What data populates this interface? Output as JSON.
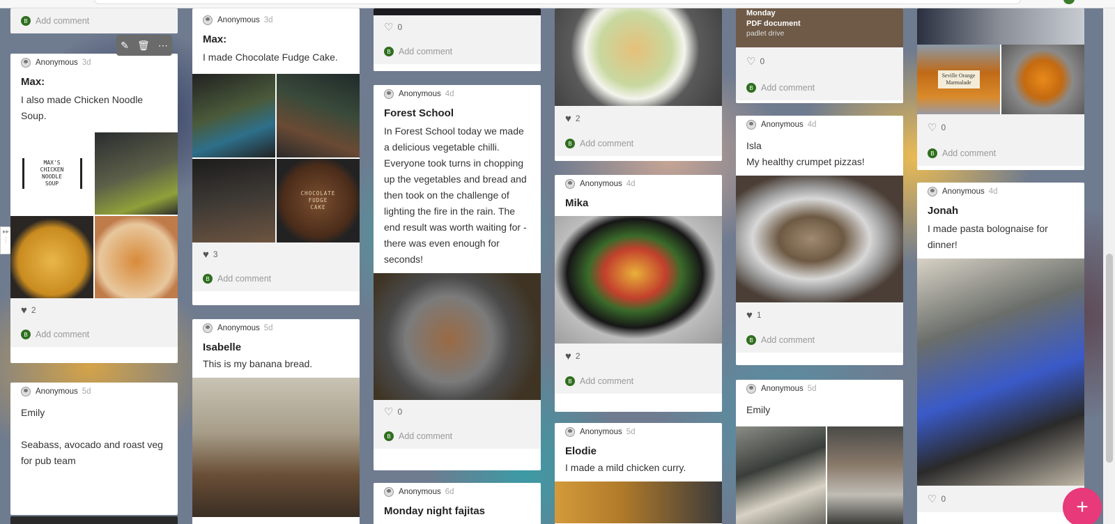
{
  "columns": [
    {
      "posts": [
        {
          "footer_only": true,
          "comment": "Add comment"
        },
        {
          "author": "Anonymous",
          "time": "3d",
          "title": "Max:",
          "body": "I also made Chicken Noodle Soup.",
          "likes": "2",
          "liked": true,
          "comment": "Add comment",
          "image_text": [
            "MAX'S",
            "CHICKEN",
            "NOODLE",
            "SOUP"
          ]
        },
        {
          "author": "Anonymous",
          "time": "5d",
          "title": "",
          "body": "Emily\n\nSeabass, avocado and roast veg for pub team"
        }
      ]
    },
    {
      "posts": [
        {
          "author": "Anonymous",
          "time": "3d",
          "title": "Max:",
          "body": "I made Chocolate Fudge Cake.",
          "likes": "3",
          "liked": true,
          "comment": "Add comment",
          "image_text": [
            "CHOCOLATE",
            "FUDGE",
            "CAKE"
          ]
        },
        {
          "author": "Anonymous",
          "time": "5d",
          "title": "Isabelle",
          "body": "This is my banana bread."
        }
      ]
    },
    {
      "posts": [
        {
          "footer_only": true,
          "likes": "0",
          "liked": false,
          "comment": "Add comment"
        },
        {
          "author": "Anonymous",
          "time": "4d",
          "title": "Forest School",
          "body": "In Forest School today we made a delicious vegetable chilli. Everyone took turns in chopping up the vegetables and bread and then took on the challenge of lighting the fire in the rain. The end result was worth waiting for - there was even enough for seconds!",
          "likes": "0",
          "liked": false,
          "comment": "Add comment"
        },
        {
          "author": "Anonymous",
          "time": "6d",
          "title": "Monday night fajitas"
        }
      ]
    },
    {
      "posts": [
        {
          "likes": "2",
          "liked": true,
          "comment": "Add comment"
        },
        {
          "author": "Anonymous",
          "time": "4d",
          "title": "Mika",
          "likes": "2",
          "liked": true,
          "comment": "Add comment"
        },
        {
          "author": "Anonymous",
          "time": "5d",
          "title": "Elodie",
          "body": "I made a mild chicken curry."
        }
      ]
    },
    {
      "posts": [
        {
          "pdf_title": "Monday",
          "pdf_type": "PDF document",
          "pdf_source": "padlet drive",
          "likes": "0",
          "liked": false,
          "comment": "Add comment"
        },
        {
          "author": "Anonymous",
          "time": "4d",
          "title": "",
          "body": "Isla\nMy healthy crumpet pizzas!",
          "likes": "1",
          "liked": true,
          "comment": "Add comment"
        },
        {
          "author": "Anonymous",
          "time": "5d",
          "title": "",
          "body": "Emily"
        }
      ]
    },
    {
      "posts": [
        {
          "likes": "0",
          "liked": false,
          "comment": "Add comment",
          "image_text": [
            "Seville Orange",
            "Marmalade"
          ]
        },
        {
          "author": "Anonymous",
          "time": "4d",
          "title": "Jonah",
          "body": "I made pasta bolognaise for dinner!",
          "likes": "0",
          "liked": false
        }
      ]
    }
  ],
  "toolbar": {
    "icons": [
      "pencil-icon",
      "trash-icon",
      "more-icon"
    ]
  },
  "fab": "+",
  "colors": {
    "accent": "#e8397a",
    "comment_avatar": "#2f6f1e"
  }
}
